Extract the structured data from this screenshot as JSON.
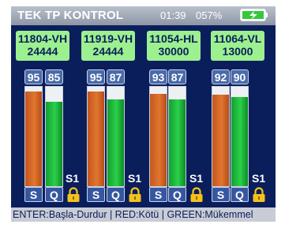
{
  "header": {
    "title": "TEK TP KONTROL",
    "time": "01:39",
    "battery_percent": "057%",
    "battery_icon": "battery-charging-icon"
  },
  "colors": {
    "background": "#0b1e5c",
    "label_bg": "#9cf08f",
    "s_bar": "#e0762e",
    "q_bar": "#2ad04a",
    "lock": "#f4c21c"
  },
  "channels": [
    {
      "label_top": "11804-VH",
      "label_bottom": "24444",
      "s_value": "95",
      "q_value": "85",
      "s_letter": "S",
      "q_letter": "Q",
      "slot": "S1"
    },
    {
      "label_top": "11919-VH",
      "label_bottom": "24444",
      "s_value": "95",
      "q_value": "87",
      "s_letter": "S",
      "q_letter": "Q",
      "slot": "S1"
    },
    {
      "label_top": "11054-HL",
      "label_bottom": "30000",
      "s_value": "93",
      "q_value": "87",
      "s_letter": "S",
      "q_letter": "Q",
      "slot": "S1"
    },
    {
      "label_top": "11064-VL",
      "label_bottom": "13000",
      "s_value": "92",
      "q_value": "90",
      "s_letter": "S",
      "q_letter": "Q",
      "slot": "S1"
    }
  ],
  "footer": {
    "text": "ENTER:Başla-Durdur | RED:Kötü | GREEN:Mükemmel"
  }
}
